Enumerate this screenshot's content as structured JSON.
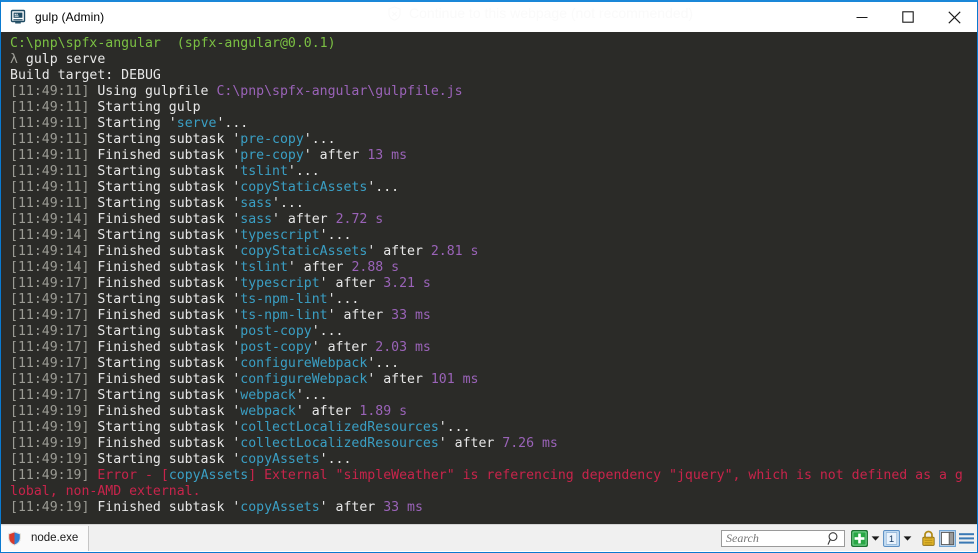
{
  "window": {
    "title": "gulp (Admin)",
    "icon": "console-icon",
    "ghost_watermark": "Continue to this webpage (not recommended)",
    "controls": {
      "minimize_label": "Minimize",
      "maximize_label": "Maximize",
      "close_label": "Close"
    }
  },
  "terminal": {
    "background": "#2b2b28",
    "colors": {
      "green": "#7bc043",
      "white": "#e8e8e8",
      "gray": "#9b9b94",
      "cyan": "#3a9fc4",
      "magenta": "#9a63b8",
      "red": "#c8244b"
    },
    "lines": [
      [
        {
          "t": "C:\\pnp\\spfx-angular",
          "c": "c-green"
        },
        {
          "t": "  ",
          "c": "c-white"
        },
        {
          "t": "(spfx-angular@0.0.1)",
          "c": "c-green"
        }
      ],
      [
        {
          "t": "λ",
          "c": "c-dim"
        },
        {
          "t": " gulp serve",
          "c": "c-white"
        }
      ],
      [
        {
          "t": "Build target: DEBUG",
          "c": "c-white"
        }
      ],
      [
        {
          "t": "[11:49:11]",
          "c": "c-gray"
        },
        {
          "t": " Using gulpfile ",
          "c": "c-white"
        },
        {
          "t": "C:\\pnp\\spfx-angular\\gulpfile.js",
          "c": "c-magenta"
        }
      ],
      [
        {
          "t": "[11:49:11]",
          "c": "c-gray"
        },
        {
          "t": " Starting gulp",
          "c": "c-white"
        }
      ],
      [
        {
          "t": "[11:49:11]",
          "c": "c-gray"
        },
        {
          "t": " Starting '",
          "c": "c-white"
        },
        {
          "t": "serve",
          "c": "c-cyan"
        },
        {
          "t": "'...",
          "c": "c-white"
        }
      ],
      [
        {
          "t": "[11:49:11]",
          "c": "c-gray"
        },
        {
          "t": " Starting subtask '",
          "c": "c-white"
        },
        {
          "t": "pre-copy",
          "c": "c-cyan"
        },
        {
          "t": "'...",
          "c": "c-white"
        }
      ],
      [
        {
          "t": "[11:49:11]",
          "c": "c-gray"
        },
        {
          "t": " Finished subtask '",
          "c": "c-white"
        },
        {
          "t": "pre-copy",
          "c": "c-cyan"
        },
        {
          "t": "' after ",
          "c": "c-white"
        },
        {
          "t": "13 ms",
          "c": "c-magenta"
        }
      ],
      [
        {
          "t": "[11:49:11]",
          "c": "c-gray"
        },
        {
          "t": " Starting subtask '",
          "c": "c-white"
        },
        {
          "t": "tslint",
          "c": "c-cyan"
        },
        {
          "t": "'...",
          "c": "c-white"
        }
      ],
      [
        {
          "t": "[11:49:11]",
          "c": "c-gray"
        },
        {
          "t": " Starting subtask '",
          "c": "c-white"
        },
        {
          "t": "copyStaticAssets",
          "c": "c-cyan"
        },
        {
          "t": "'...",
          "c": "c-white"
        }
      ],
      [
        {
          "t": "[11:49:11]",
          "c": "c-gray"
        },
        {
          "t": " Starting subtask '",
          "c": "c-white"
        },
        {
          "t": "sass",
          "c": "c-cyan"
        },
        {
          "t": "'...",
          "c": "c-white"
        }
      ],
      [
        {
          "t": "[11:49:14]",
          "c": "c-gray"
        },
        {
          "t": " Finished subtask '",
          "c": "c-white"
        },
        {
          "t": "sass",
          "c": "c-cyan"
        },
        {
          "t": "' after ",
          "c": "c-white"
        },
        {
          "t": "2.72 s",
          "c": "c-magenta"
        }
      ],
      [
        {
          "t": "[11:49:14]",
          "c": "c-gray"
        },
        {
          "t": " Starting subtask '",
          "c": "c-white"
        },
        {
          "t": "typescript",
          "c": "c-cyan"
        },
        {
          "t": "'...",
          "c": "c-white"
        }
      ],
      [
        {
          "t": "[11:49:14]",
          "c": "c-gray"
        },
        {
          "t": " Finished subtask '",
          "c": "c-white"
        },
        {
          "t": "copyStaticAssets",
          "c": "c-cyan"
        },
        {
          "t": "' after ",
          "c": "c-white"
        },
        {
          "t": "2.81 s",
          "c": "c-magenta"
        }
      ],
      [
        {
          "t": "[11:49:14]",
          "c": "c-gray"
        },
        {
          "t": " Finished subtask '",
          "c": "c-white"
        },
        {
          "t": "tslint",
          "c": "c-cyan"
        },
        {
          "t": "' after ",
          "c": "c-white"
        },
        {
          "t": "2.88 s",
          "c": "c-magenta"
        }
      ],
      [
        {
          "t": "[11:49:17]",
          "c": "c-gray"
        },
        {
          "t": " Finished subtask '",
          "c": "c-white"
        },
        {
          "t": "typescript",
          "c": "c-cyan"
        },
        {
          "t": "' after ",
          "c": "c-white"
        },
        {
          "t": "3.21 s",
          "c": "c-magenta"
        }
      ],
      [
        {
          "t": "[11:49:17]",
          "c": "c-gray"
        },
        {
          "t": " Starting subtask '",
          "c": "c-white"
        },
        {
          "t": "ts-npm-lint",
          "c": "c-cyan"
        },
        {
          "t": "'...",
          "c": "c-white"
        }
      ],
      [
        {
          "t": "[11:49:17]",
          "c": "c-gray"
        },
        {
          "t": " Finished subtask '",
          "c": "c-white"
        },
        {
          "t": "ts-npm-lint",
          "c": "c-cyan"
        },
        {
          "t": "' after ",
          "c": "c-white"
        },
        {
          "t": "33 ms",
          "c": "c-magenta"
        }
      ],
      [
        {
          "t": "[11:49:17]",
          "c": "c-gray"
        },
        {
          "t": " Starting subtask '",
          "c": "c-white"
        },
        {
          "t": "post-copy",
          "c": "c-cyan"
        },
        {
          "t": "'...",
          "c": "c-white"
        }
      ],
      [
        {
          "t": "[11:49:17]",
          "c": "c-gray"
        },
        {
          "t": " Finished subtask '",
          "c": "c-white"
        },
        {
          "t": "post-copy",
          "c": "c-cyan"
        },
        {
          "t": "' after ",
          "c": "c-white"
        },
        {
          "t": "2.03 ms",
          "c": "c-magenta"
        }
      ],
      [
        {
          "t": "[11:49:17]",
          "c": "c-gray"
        },
        {
          "t": " Starting subtask '",
          "c": "c-white"
        },
        {
          "t": "configureWebpack",
          "c": "c-cyan"
        },
        {
          "t": "'...",
          "c": "c-white"
        }
      ],
      [
        {
          "t": "[11:49:17]",
          "c": "c-gray"
        },
        {
          "t": " Finished subtask '",
          "c": "c-white"
        },
        {
          "t": "configureWebpack",
          "c": "c-cyan"
        },
        {
          "t": "' after ",
          "c": "c-white"
        },
        {
          "t": "101 ms",
          "c": "c-magenta"
        }
      ],
      [
        {
          "t": "[11:49:17]",
          "c": "c-gray"
        },
        {
          "t": " Starting subtask '",
          "c": "c-white"
        },
        {
          "t": "webpack",
          "c": "c-cyan"
        },
        {
          "t": "'...",
          "c": "c-white"
        }
      ],
      [
        {
          "t": "[11:49:19]",
          "c": "c-gray"
        },
        {
          "t": " Finished subtask '",
          "c": "c-white"
        },
        {
          "t": "webpack",
          "c": "c-cyan"
        },
        {
          "t": "' after ",
          "c": "c-white"
        },
        {
          "t": "1.89 s",
          "c": "c-magenta"
        }
      ],
      [
        {
          "t": "[11:49:19]",
          "c": "c-gray"
        },
        {
          "t": " Starting subtask '",
          "c": "c-white"
        },
        {
          "t": "collectLocalizedResources",
          "c": "c-cyan"
        },
        {
          "t": "'...",
          "c": "c-white"
        }
      ],
      [
        {
          "t": "[11:49:19]",
          "c": "c-gray"
        },
        {
          "t": " Finished subtask '",
          "c": "c-white"
        },
        {
          "t": "collectLocalizedResources",
          "c": "c-cyan"
        },
        {
          "t": "' after ",
          "c": "c-white"
        },
        {
          "t": "7.26 ms",
          "c": "c-magenta"
        }
      ],
      [
        {
          "t": "[11:49:19]",
          "c": "c-gray"
        },
        {
          "t": " Starting subtask '",
          "c": "c-white"
        },
        {
          "t": "copyAssets",
          "c": "c-cyan"
        },
        {
          "t": "'...",
          "c": "c-white"
        }
      ],
      [
        {
          "t": "[11:49:19]",
          "c": "c-gray"
        },
        {
          "t": " Error - [",
          "c": "c-red"
        },
        {
          "t": "copyAssets",
          "c": "c-cyan"
        },
        {
          "t": "] External \"simpleWeather\" is referencing dependency \"jquery\", which is not defined as a g",
          "c": "c-red"
        }
      ],
      [
        {
          "t": "lobal, non-AMD external.",
          "c": "c-red"
        }
      ],
      [
        {
          "t": "[11:49:19]",
          "c": "c-gray"
        },
        {
          "t": " Finished subtask '",
          "c": "c-white"
        },
        {
          "t": "copyAssets",
          "c": "c-cyan"
        },
        {
          "t": "' after ",
          "c": "c-white"
        },
        {
          "t": "33 ms",
          "c": "c-magenta"
        }
      ]
    ]
  },
  "statusbar": {
    "process_label": "node.exe",
    "process_icon": "uac-shield-icon",
    "search": {
      "placeholder": "Search",
      "value": "",
      "icon": "magnifier-icon"
    },
    "buttons": [
      {
        "name": "new-console-button",
        "icon": "green-plus-icon",
        "label": ""
      },
      {
        "name": "new-console-dropdown",
        "icon": "chevron-down-icon",
        "label": ""
      },
      {
        "name": "active-console-button",
        "icon": "console-number-icon",
        "label": "1"
      },
      {
        "name": "active-console-dropdown",
        "icon": "chevron-down-icon",
        "label": ""
      },
      {
        "name": "elevated-lock-button",
        "icon": "padlock-icon",
        "label": ""
      },
      {
        "name": "panel-view-button",
        "icon": "panel-split-icon",
        "label": ""
      },
      {
        "name": "main-menu-button",
        "icon": "hamburger-menu-icon",
        "label": ""
      }
    ]
  }
}
